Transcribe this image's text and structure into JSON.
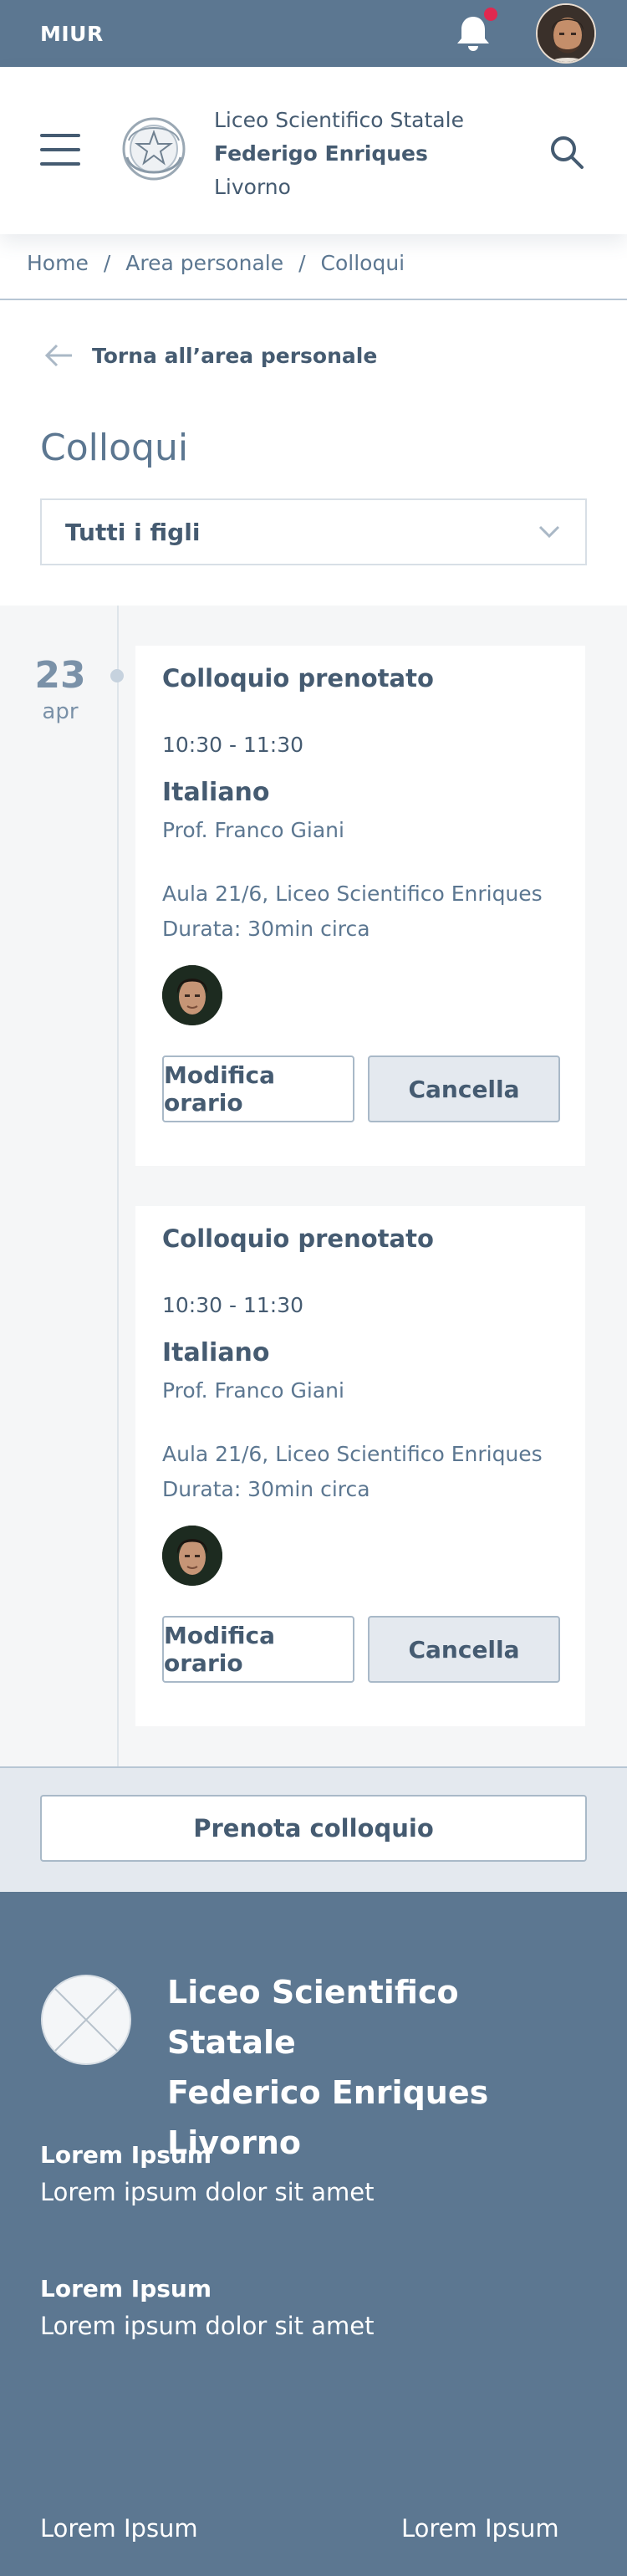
{
  "topbar": {
    "brand": "MIUR",
    "notifications": {
      "icon": "bell-icon",
      "has_unread": true
    }
  },
  "header": {
    "school_line1": "Liceo Scientifico Statale",
    "school_line2": "Federigo Enriques",
    "school_line3": "Livorno"
  },
  "breadcrumb": {
    "items": [
      "Home",
      "Area personale",
      "Colloqui"
    ],
    "separator": "/"
  },
  "back_link": "Torna all’area personale",
  "page_title": "Colloqui",
  "filter": {
    "selected": "Tutti i figli"
  },
  "timeline": {
    "day": "23",
    "month": "apr",
    "appointments": [
      {
        "status": "Colloquio prenotato",
        "time": "10:30 - 11:30",
        "subject": "Italiano",
        "teacher": "Prof. Franco Giani",
        "room": "Aula 21/6, Liceo Scientifico Enriques",
        "duration": "Durata: 30min circa",
        "edit_label": "Modifica orario",
        "cancel_label": "Cancella"
      },
      {
        "status": "Colloquio prenotato",
        "time": "10:30 - 11:30",
        "subject": "Italiano",
        "teacher": "Prof. Franco Giani",
        "room": "Aula 21/6, Liceo Scientifico Enriques",
        "duration": "Durata: 30min circa",
        "edit_label": "Modifica orario",
        "cancel_label": "Cancella"
      }
    ]
  },
  "book_button": "Prenota colloquio",
  "footer": {
    "title_line1": "Liceo Scientifico Statale",
    "title_line2": "Federico Enriques",
    "title_line3": "Livorno",
    "sections": [
      {
        "heading": "Lorem Ipsum",
        "text": "Lorem ipsum dolor sit amet"
      },
      {
        "heading": "Lorem Ipsum",
        "text": "Lorem ipsum dolor sit amet"
      }
    ],
    "bottom_left": "Lorem Ipsum",
    "bottom_right": "Lorem Ipsum"
  },
  "colors": {
    "primary": "#5c7791",
    "text": "#455b71",
    "notification": "#e0284f",
    "timeline_bg": "#f5f6f7",
    "action_bg": "#e4e9ef"
  }
}
